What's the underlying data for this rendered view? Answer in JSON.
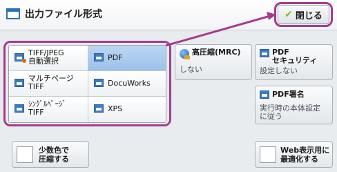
{
  "header": {
    "title": "出力ファイル形式",
    "close_label": "閉じる",
    "icon": "document-icon",
    "check_icon": "checkmark-icon"
  },
  "format_options": [
    {
      "id": "tiff-jpeg-auto",
      "label": "TIFF/JPEG\n自動選択",
      "icon": "image-file-icon",
      "selected": false
    },
    {
      "id": "pdf",
      "label": "PDF",
      "icon": "pdf-file-icon",
      "selected": true
    },
    {
      "id": "multi-page-tiff",
      "label": "マルチページ\nTIFF",
      "icon": "tiff-file-icon",
      "selected": false
    },
    {
      "id": "docuworks",
      "label": "DocuWorks",
      "icon": "docuworks-file-icon",
      "selected": false
    },
    {
      "id": "single-page-tiff",
      "label": "ｼﾝｸﾞﾙﾍﾟｰｼﾞ\nTIFF",
      "icon": "tiff-file-icon",
      "selected": false
    },
    {
      "id": "xps",
      "label": "XPS",
      "icon": "xps-file-icon",
      "selected": false
    }
  ],
  "compression": {
    "title": "高圧縮(MRC)",
    "value": "しない",
    "icon": "compression-icon"
  },
  "pdf_security": {
    "title": "PDF\nセキュリティ",
    "value": "設定しない",
    "icon": "security-icon"
  },
  "pdf_signature": {
    "title": "PDF署名",
    "value": "実行時の本体設定\nに従う",
    "icon": "signature-icon"
  },
  "reduce_colors": {
    "label": "少数色で\n圧縮する",
    "checked": false
  },
  "web_optimize": {
    "label": "Web表示用に\n最適化する",
    "checked": false
  },
  "colors": {
    "highlight": "#a43b8d",
    "selected": "#9cc1ea",
    "accent": "#2d6fb8"
  }
}
